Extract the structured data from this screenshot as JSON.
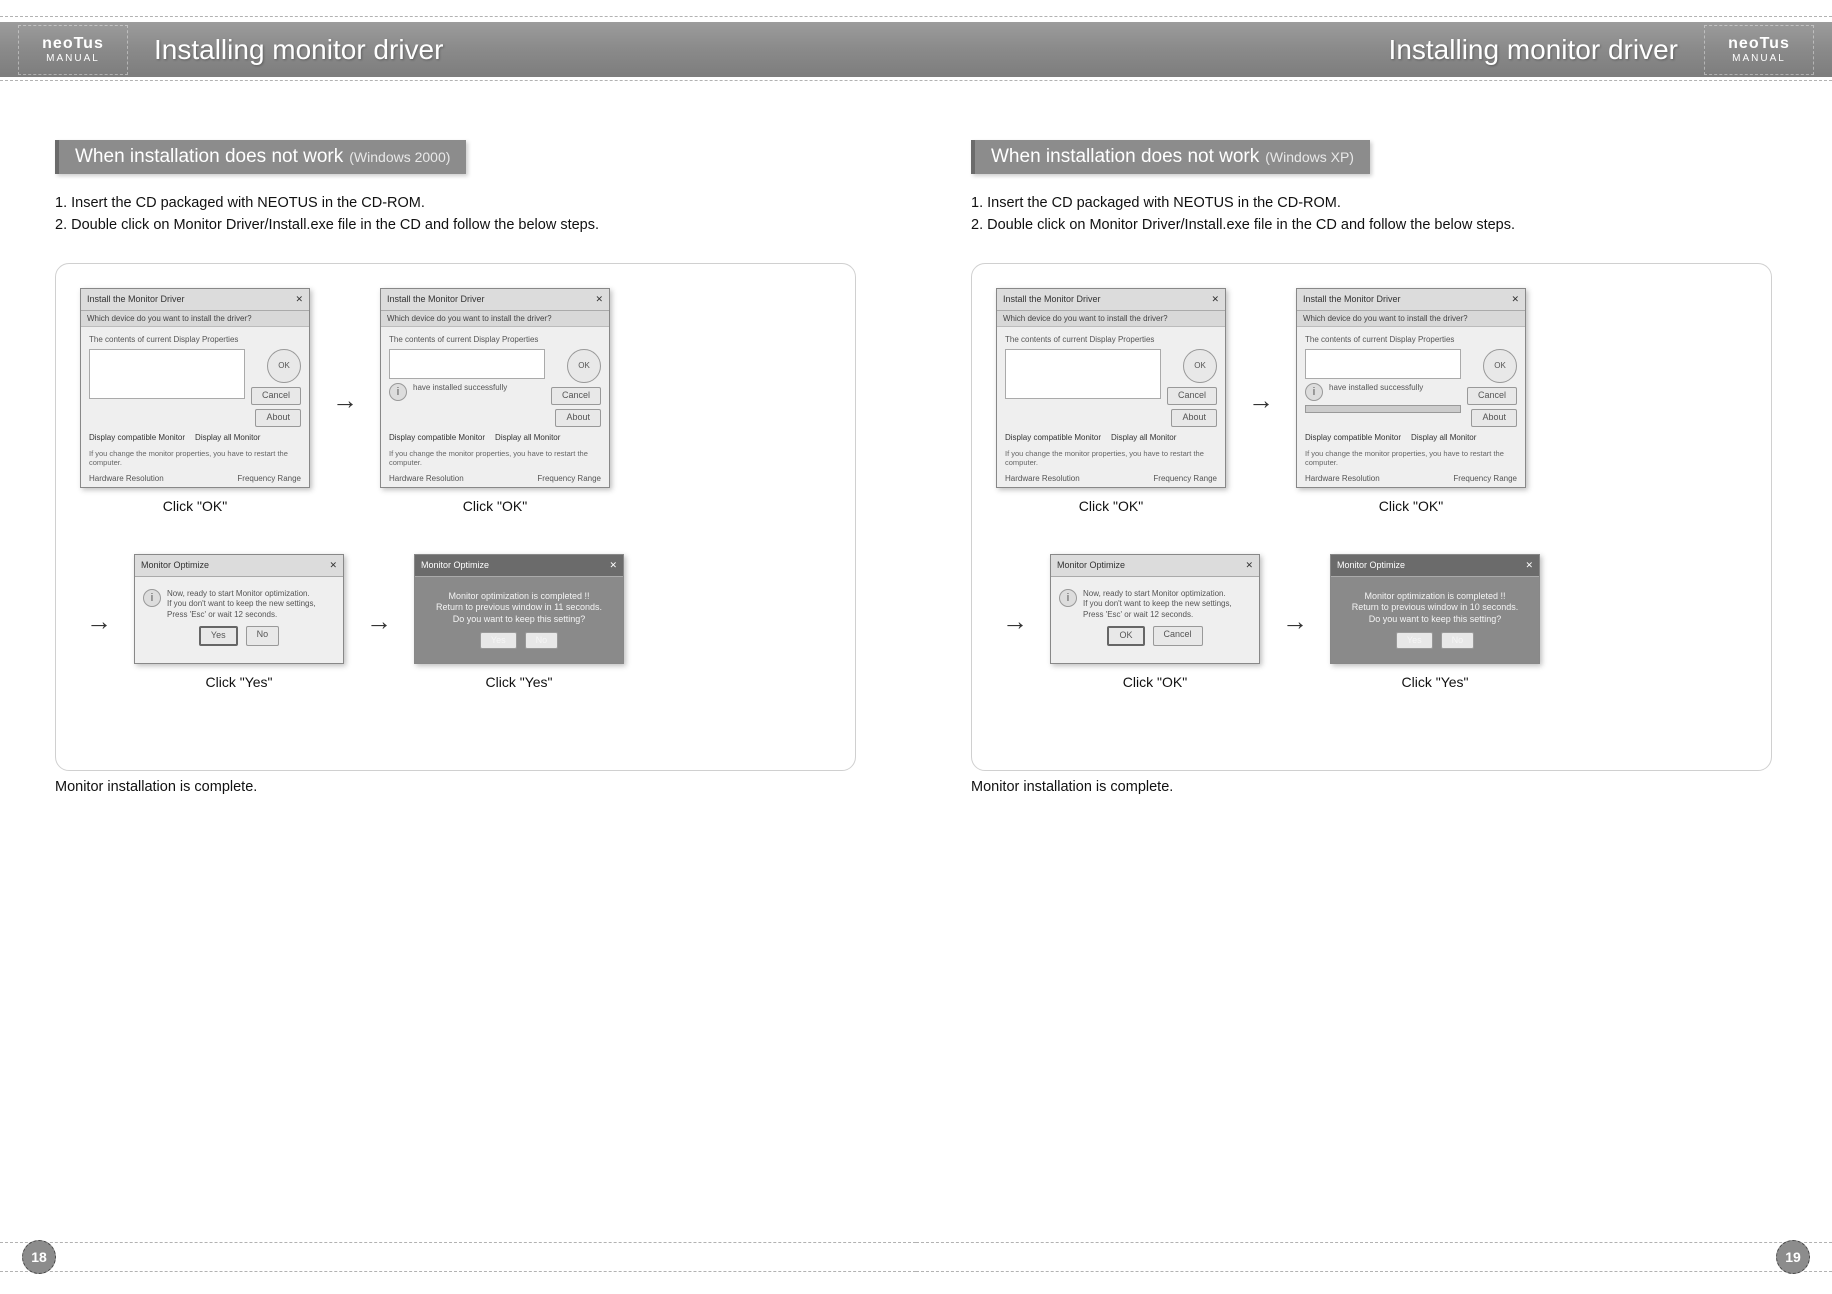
{
  "brand": {
    "name": "neoTus",
    "sub": "MANUAL"
  },
  "header": {
    "title_left": "Installing monitor driver",
    "title_right": "Installing monitor driver"
  },
  "left": {
    "section_main": "When installation does not work",
    "section_sub": "(Windows 2000)",
    "steps": [
      "1. Insert the CD packaged with NEOTUS in the CD-ROM.",
      "2. Double click on Monitor Driver/Install.exe file in the CD and follow the below steps."
    ],
    "captions": {
      "a": "Click \"OK\"",
      "b": "Click \"OK\"",
      "c": "Click \"Yes\"",
      "d": "Click \"Yes\""
    },
    "footer": "Monitor installation is complete.",
    "dlg": {
      "title": "Install the Monitor Driver",
      "subtitle": "Which device do you want to install the driver?",
      "panel_label": "The contents of current Display Properties",
      "check1": "Display compatible Monitor",
      "check2": "Display all Monitor",
      "btn_ok": "OK",
      "btn_cancel": "Cancel",
      "btn_about": "About",
      "hw_label": "Hardware Resolution",
      "freq_label": "Frequency Range"
    },
    "confirm": {
      "title": "Monitor Optimize",
      "line1": "Now, ready to start Monitor optimization.",
      "line2": "If you don't want to keep the new settings,",
      "line3": "Press 'Esc' or wait 12 seconds.",
      "btn_yes": "Yes",
      "btn_no": "No"
    },
    "done": {
      "title": "Monitor Optimize",
      "line1": "Monitor optimization is completed !!",
      "line2": "Return to previous window in 11 seconds.",
      "line3": "Do you want to keep this setting?",
      "btn_yes": "Yes",
      "btn_no": "No"
    }
  },
  "right": {
    "section_main": "When installation does not work",
    "section_sub": "(Windows XP)",
    "steps": [
      "1. Insert the CD packaged with NEOTUS in the CD-ROM.",
      "2. Double click on Monitor Driver/Install.exe file in the CD and follow the below steps."
    ],
    "captions": {
      "a": "Click \"OK\"",
      "b": "Click \"OK\"",
      "c": "Click \"OK\"",
      "d": "Click \"Yes\""
    },
    "footer": "Monitor installation is complete.",
    "dlg": {
      "title": "Install the Monitor Driver",
      "subtitle": "Which device do you want to install the driver?",
      "panel_label": "The contents of current Display Properties",
      "check1": "Display compatible Monitor",
      "check2": "Display all Monitor",
      "btn_ok": "OK",
      "btn_cancel": "Cancel",
      "btn_about": "About",
      "hw_label": "Hardware Resolution",
      "freq_label": "Frequency Range",
      "prog_label": "have installed successfully"
    },
    "confirm": {
      "title": "Monitor Optimize",
      "line1": "Now, ready to start Monitor optimization.",
      "line2": "If you don't want to keep the new settings,",
      "line3": "Press 'Esc' or wait 12 seconds.",
      "btn_ok": "OK",
      "btn_cancel": "Cancel"
    },
    "done": {
      "title": "Monitor Optimize",
      "line1": "Monitor optimization is completed !!",
      "line2": "Return to previous window in 10 seconds.",
      "line3": "Do you want to keep this setting?",
      "btn_yes": "Yes",
      "btn_no": "No"
    }
  },
  "pages": {
    "left": "18",
    "right": "19"
  },
  "arrow": "→"
}
